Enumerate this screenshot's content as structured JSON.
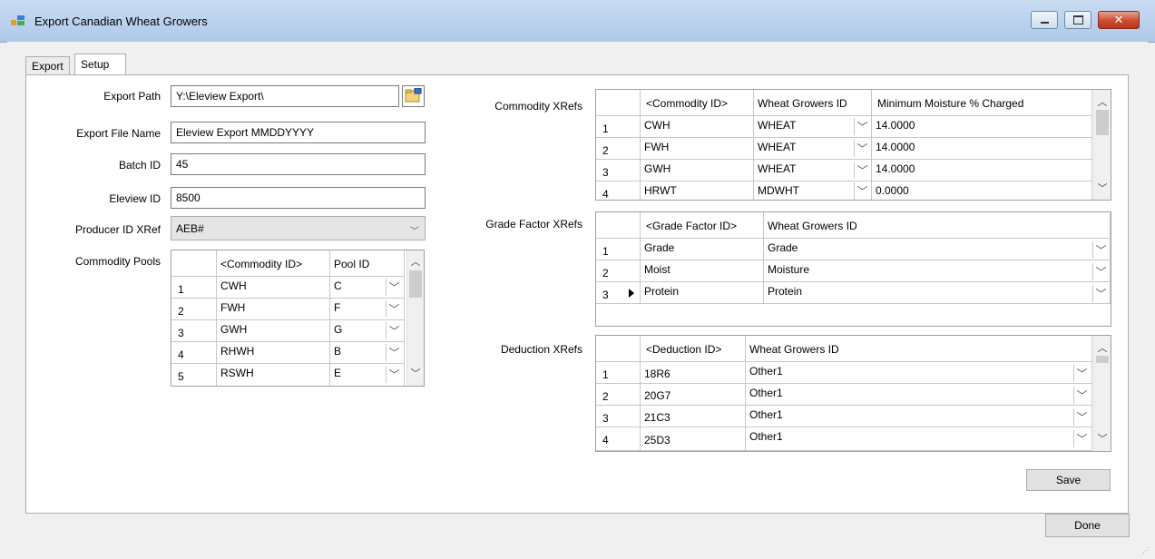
{
  "window": {
    "title": "Export Canadian Wheat Growers"
  },
  "tabs": [
    {
      "label": "Export"
    },
    {
      "label": "Setup"
    }
  ],
  "setup": {
    "export_path": {
      "label": "Export Path",
      "value": "Y:\\Eleview Export\\"
    },
    "export_file_name": {
      "label": "Export File Name",
      "value": "Eleview Export MMDDYYYY"
    },
    "batch_id": {
      "label": "Batch ID",
      "value": "45"
    },
    "eleview_id": {
      "label": "Eleview ID",
      "value": "8500"
    },
    "producer_id_xref": {
      "label": "Producer ID XRef",
      "value": "AEB#"
    },
    "commodity_pools": {
      "label": "Commodity Pools",
      "headers": [
        "<Commodity ID>",
        "Pool ID"
      ],
      "rows": [
        {
          "n": "1",
          "commodity": "CWH",
          "pool": "C"
        },
        {
          "n": "2",
          "commodity": "FWH",
          "pool": "F"
        },
        {
          "n": "3",
          "commodity": "GWH",
          "pool": "G"
        },
        {
          "n": "4",
          "commodity": "RHWH",
          "pool": "B"
        },
        {
          "n": "5",
          "commodity": "RSWH",
          "pool": "E"
        }
      ]
    },
    "commodity_xrefs": {
      "label": "Commodity XRefs",
      "headers": [
        "<Commodity ID>",
        "Wheat Growers ID",
        "Minimum Moisture % Charged"
      ],
      "rows": [
        {
          "n": "1",
          "commodity": "CWH",
          "wg": "WHEAT",
          "moist": "14.0000"
        },
        {
          "n": "2",
          "commodity": "FWH",
          "wg": "WHEAT",
          "moist": "14.0000"
        },
        {
          "n": "3",
          "commodity": "GWH",
          "wg": "WHEAT",
          "moist": "14.0000"
        },
        {
          "n": "4",
          "commodity": "HRWT",
          "wg": "MDWHT",
          "moist": "0.0000"
        }
      ]
    },
    "grade_factor_xrefs": {
      "label": "Grade Factor XRefs",
      "headers": [
        "<Grade Factor ID>",
        "Wheat Growers ID"
      ],
      "rows": [
        {
          "n": "1",
          "factor": "Grade",
          "wg": "Grade"
        },
        {
          "n": "2",
          "factor": "Moist",
          "wg": "Moisture"
        },
        {
          "n": "3",
          "factor": "Protein",
          "wg": "Protein"
        }
      ]
    },
    "deduction_xrefs": {
      "label": "Deduction XRefs",
      "headers": [
        "<Deduction ID>",
        "Wheat Growers ID"
      ],
      "rows": [
        {
          "n": "1",
          "deduction": "18R6",
          "wg": "Other1"
        },
        {
          "n": "2",
          "deduction": "20G7",
          "wg": "Other1"
        },
        {
          "n": "3",
          "deduction": "21C3",
          "wg": "Other1"
        },
        {
          "n": "4",
          "deduction": "25D3",
          "wg": "Other1"
        }
      ]
    },
    "save_label": "Save"
  },
  "done_label": "Done"
}
